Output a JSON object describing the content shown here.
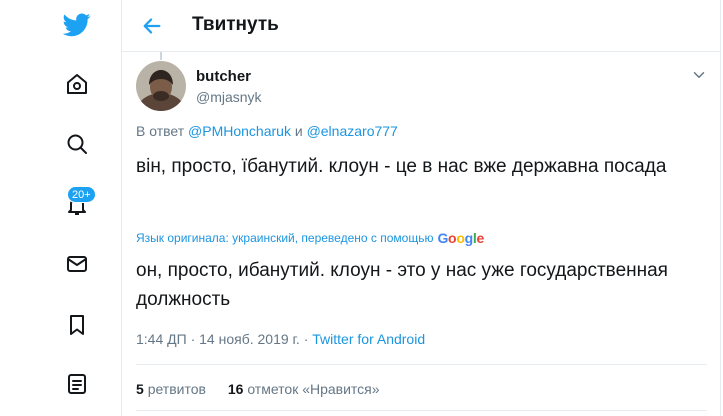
{
  "sidebar": {
    "icons": [
      "twitter-logo-icon",
      "home-icon",
      "explore-icon",
      "notifications-icon",
      "messages-icon",
      "bookmarks-icon",
      "lists-icon"
    ],
    "notification_badge": "20+"
  },
  "header": {
    "title": "Твитнуть",
    "back_icon": "arrow-left-icon"
  },
  "tweet": {
    "display_name": "butcher",
    "handle": "@mjasnyk",
    "reply_prefix": "В ответ",
    "reply_mention_1": "@PMHoncharuk",
    "reply_conjunction": "и",
    "reply_mention_2": "@elnazaro777",
    "text": "він, просто, їбанутий. клоун - це в нас вже державна посада",
    "translation_note": "Язык оригинала: украинский, переведено с помощью",
    "translation_provider": "Google",
    "translated_text": "он, просто, ибанутий. клоун - это у нас уже государственная должность",
    "time": "1:44 ДП",
    "separator": "·",
    "date": "14 нояб. 2019 г.",
    "source": "Twitter for Android",
    "retweets_count": "5",
    "retweets_label": "ретвитов",
    "likes_count": "16",
    "likes_label": "отметок «Нравится»"
  },
  "colors": {
    "accent": "#1da1f2",
    "link": "#1b95e0",
    "text": "#14171a",
    "secondary": "#657786",
    "border": "#e6ecf0"
  }
}
